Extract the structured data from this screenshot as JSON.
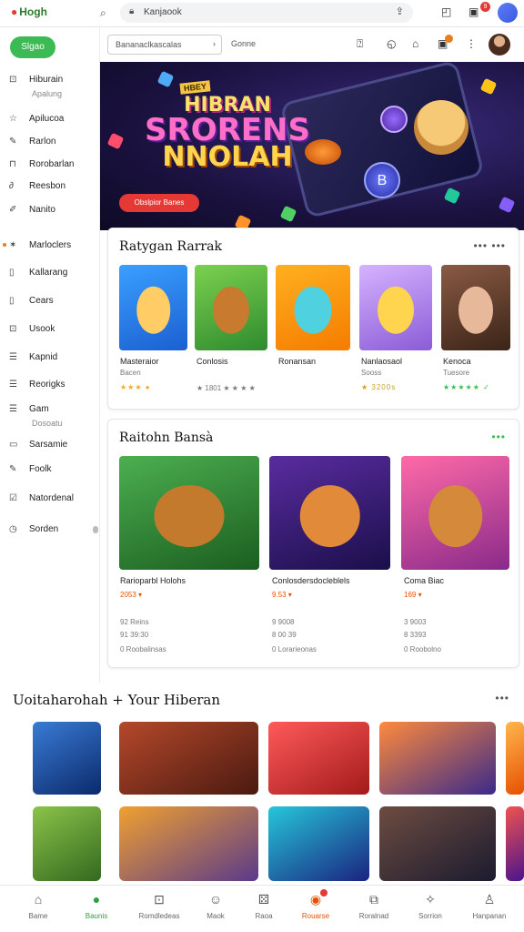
{
  "topbar": {
    "logo": "Hogh",
    "url": "Kanjaook"
  },
  "sidebar": {
    "pill": "Slgao",
    "items": [
      {
        "icon": "home-icon",
        "label": "Hiburain",
        "sub": "Apalung"
      },
      {
        "icon": "star-icon",
        "label": "Apilucoa"
      },
      {
        "icon": "edit-icon",
        "label": "Rarlon"
      },
      {
        "icon": "bookmark-icon",
        "label": "Rorobarlan"
      },
      {
        "icon": "link-icon",
        "label": "Reesbon"
      },
      {
        "icon": "pen-icon",
        "label": "Nanito"
      },
      {
        "icon": "star-icon",
        "label": "Marloclers"
      },
      {
        "icon": "page-icon",
        "label": "Kallarang"
      },
      {
        "icon": "page-icon",
        "label": "Cears"
      },
      {
        "icon": "info-icon",
        "label": "Usook"
      },
      {
        "icon": "list-icon",
        "label": "Kapnid"
      },
      {
        "icon": "list-icon",
        "label": "Reorigks"
      },
      {
        "icon": "list-icon",
        "label": "Gam",
        "sub": "Dosoatu"
      },
      {
        "icon": "square-icon",
        "label": "Sarsamie"
      },
      {
        "icon": "edit-icon",
        "label": "Foolk"
      },
      {
        "icon": "check-icon",
        "label": "Natordenal"
      },
      {
        "icon": "clock-icon",
        "label": "Sorden"
      }
    ]
  },
  "header": {
    "select": "Bananaclkascalas",
    "genre": "Gonne"
  },
  "hero": {
    "tag": "HBEY",
    "title_lines": [
      "HIBRAN",
      "SRORENS",
      "NNOLAH"
    ],
    "cta": "Obslpior Banes"
  },
  "section1": {
    "title": "Ratygan Rarrak",
    "more": "••• •••",
    "games": [
      {
        "name": "Masteraior",
        "sub": "Bacen",
        "stars": "★★★ ●"
      },
      {
        "name": "Conlosis",
        "sub": "★ 1801 ★ ★ ★ ★",
        "stars": ""
      },
      {
        "name": "Ronansan",
        "sub": "",
        "stars": ""
      },
      {
        "name": "Nanlaosaol",
        "sub": "Sooss",
        "stars": "★ 3200s"
      },
      {
        "name": "Kenoca",
        "sub": "Tuesore",
        "stars": "★★★★★ ✓"
      }
    ]
  },
  "section2": {
    "title": "Raitohn Bansà",
    "more": "•••",
    "games": [
      {
        "name": "Rarioparbl Holohs",
        "tag": "2053 ▾",
        "meta1": "92 Reins",
        "meta2": "91 39:30",
        "meta3": "0 Roobalinsas"
      },
      {
        "name": "Conlosdersdocleblels",
        "tag": "9.53 ▾",
        "meta1": "9 9008",
        "meta2": "8 00 39",
        "meta3": "0 Lorarieonas"
      },
      {
        "name": "Coma Biac",
        "tag": "169 ▾",
        "meta1": "3 9003",
        "meta2": "8 3393",
        "meta3": "0 Roobolno"
      }
    ]
  },
  "recommend": {
    "title": "Uoitaharohah + Your Hiberan",
    "more": "•••"
  },
  "bottomnav": [
    {
      "label": "Bame",
      "icon": "home-icon"
    },
    {
      "label": "Baunis",
      "icon": "chat-icon"
    },
    {
      "label": "Romdledeas",
      "icon": "grid-icon"
    },
    {
      "label": "Maok",
      "icon": "controller-icon"
    },
    {
      "label": "Raoa",
      "icon": "dice-icon"
    },
    {
      "label": "Rouarse",
      "icon": "fire-icon"
    },
    {
      "label": "Roralnad",
      "icon": "image-icon"
    },
    {
      "label": "Sorrion",
      "icon": "compass-icon"
    },
    {
      "label": "Hanpanan",
      "icon": "user-icon"
    }
  ],
  "colors": {
    "accent": "#3cba54",
    "hero_bg": "#1b1240",
    "cta": "#e53935"
  }
}
